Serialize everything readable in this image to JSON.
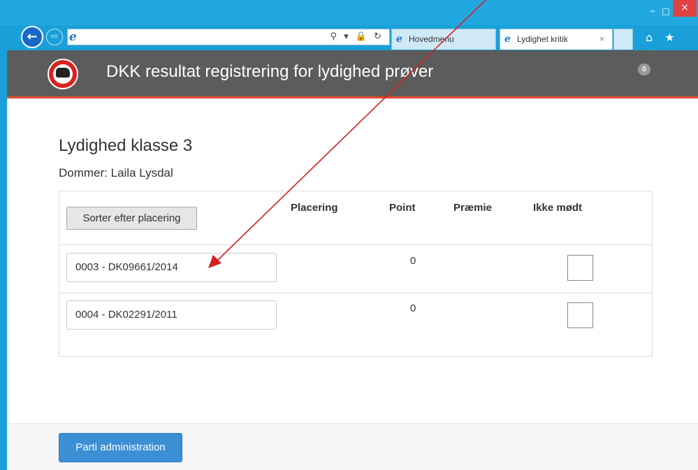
{
  "window": {
    "min_glyph": "–",
    "max_glyph": "□",
    "close_glyph": "×"
  },
  "browser": {
    "back_glyph": "←",
    "forward_glyph": "⇨",
    "address_icon": "ie-icon",
    "address_tools": "⚲ ▾ 🔒 ↻",
    "tabs": [
      {
        "label": "Hovedmenu",
        "icon": "ie-icon",
        "active": false
      },
      {
        "label": "Lydighet kritik",
        "icon": "ie-icon",
        "active": true,
        "close": "×"
      }
    ],
    "nav_icons": "⌂ ★ ⚙"
  },
  "app": {
    "title": "DKK resultat registrering for lydighed prøver",
    "badge_count": "0",
    "header_color": "#5c5c5c",
    "accent_color": "#e2492b"
  },
  "page": {
    "heading": "Lydighed klasse 3",
    "judge": "Dommer: Laila Lysdal"
  },
  "results": {
    "sort_button": "Sorter efter placering",
    "columns": {
      "placering": "Placering",
      "point": "Point",
      "praemie": "Præmie",
      "ikke_modt": "Ikke mødt"
    },
    "rows": [
      {
        "dog": "0003 - DK09661/2014",
        "point": "0",
        "not_attended": false
      },
      {
        "dog": "0004 - DK02291/2011",
        "point": "0",
        "not_attended": false
      }
    ]
  },
  "footer": {
    "admin_button": "Parti administration",
    "button_color": "#3b8fd4"
  },
  "annotation": {
    "arrow_color": "#d42020"
  }
}
